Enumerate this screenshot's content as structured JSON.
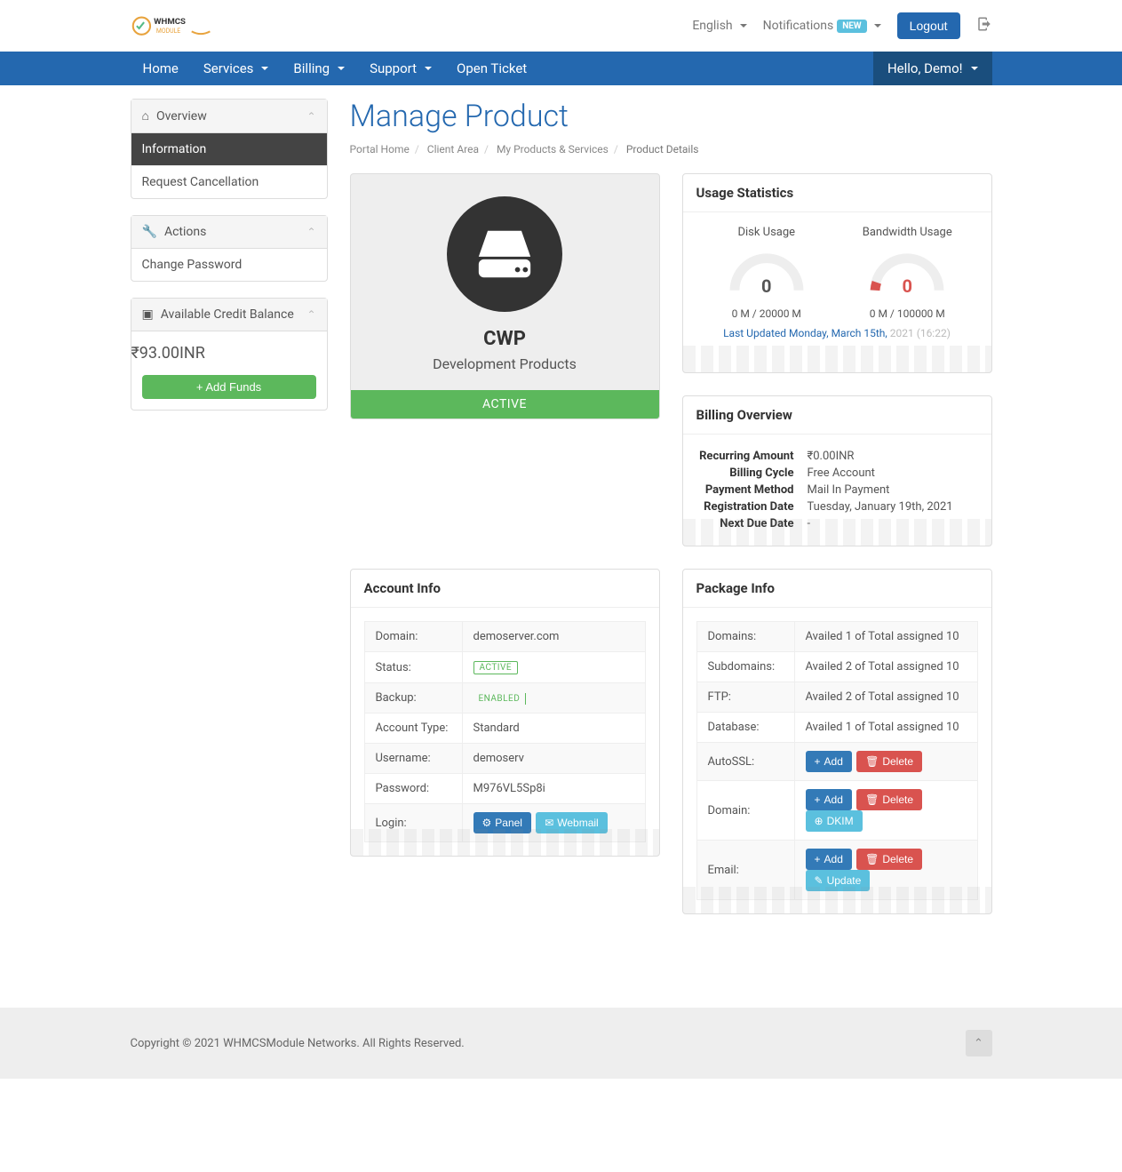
{
  "top": {
    "language": "English",
    "notifications": "Notifications",
    "notif_badge": "NEW",
    "logout": "Logout"
  },
  "nav": {
    "home": "Home",
    "services": "Services",
    "billing": "Billing",
    "support": "Support",
    "open_ticket": "Open Ticket",
    "hello": "Hello, Demo!"
  },
  "sidebar": {
    "overview": {
      "title": "Overview",
      "information": "Information",
      "cancel": "Request Cancellation"
    },
    "actions": {
      "title": "Actions",
      "change_pw": "Change Password"
    },
    "credit": {
      "title": "Available Credit Balance",
      "amount": "₹93.00INR",
      "add_funds": "Add Funds"
    }
  },
  "page": {
    "title": "Manage Product",
    "crumbs": {
      "home": "Portal Home",
      "client": "Client Area",
      "products": "My Products & Services",
      "details": "Product Details"
    }
  },
  "product": {
    "name": "CWP",
    "category": "Development Products",
    "status": "ACTIVE"
  },
  "usage": {
    "title": "Usage Statistics",
    "disk": {
      "label": "Disk Usage",
      "value": "0",
      "text": "0 M / 20000 M"
    },
    "bw": {
      "label": "Bandwidth Usage",
      "value": "0",
      "text": "0 M / 100000 M"
    },
    "updated_blue": "Last Updated Monday, March 15th,",
    "updated_grey": " 2021 (16:22)"
  },
  "billing": {
    "title": "Billing Overview",
    "rows": {
      "recurring_l": "Recurring Amount",
      "recurring_v": "₹0.00INR",
      "cycle_l": "Billing Cycle",
      "cycle_v": "Free Account",
      "method_l": "Payment Method",
      "method_v": "Mail In Payment",
      "reg_l": "Registration Date",
      "reg_v": "Tuesday, January 19th, 2021",
      "due_l": "Next Due Date",
      "due_v": "-"
    }
  },
  "account": {
    "title": "Account Info",
    "domain_l": "Domain:",
    "domain_v": "demoserver.com",
    "status_l": "Status:",
    "status_v": "ACTIVE",
    "backup_l": "Backup:",
    "backup_v": "ENABLED",
    "type_l": "Account Type:",
    "type_v": "Standard",
    "user_l": "Username:",
    "user_v": "demoserv",
    "pass_l": "Password:",
    "pass_v": "M976VL5Sp8i",
    "login_l": "Login:",
    "panel_btn": "Panel",
    "webmail_btn": "Webmail"
  },
  "package": {
    "title": "Package Info",
    "domains_l": "Domains:",
    "domains_v": "Availed 1 of Total assigned 10",
    "sub_l": "Subdomains:",
    "sub_v": "Availed 2 of Total assigned 10",
    "ftp_l": "FTP:",
    "ftp_v": "Availed 2 of Total assigned 10",
    "db_l": "Database:",
    "db_v": "Availed 1 of Total assigned 10",
    "autossl_l": "AutoSSL:",
    "domain_l": "Domain:",
    "email_l": "Email:",
    "add_btn": "Add",
    "delete_btn": "Delete",
    "dkim_btn": "DKIM",
    "update_btn": "Update"
  },
  "footer": {
    "copyright": "Copyright © 2021 WHMCSModule Networks. All Rights Reserved."
  }
}
